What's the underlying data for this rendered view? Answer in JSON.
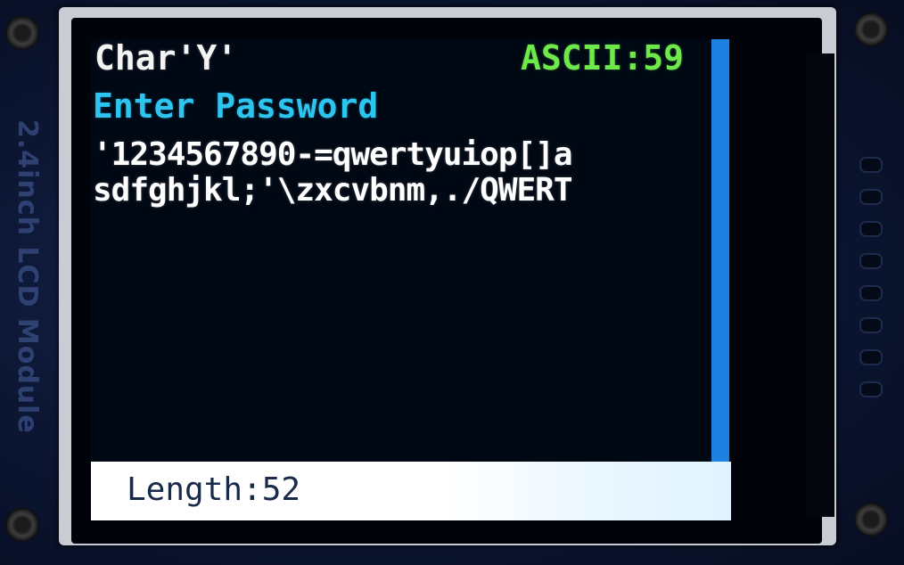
{
  "module": {
    "side_label": "2.4inch LCD Module"
  },
  "display": {
    "char_label": "Char'Y'",
    "ascii_label": "ASCII:59",
    "prompt": "Enter Password",
    "password_lines": [
      "'1234567890-=qwertyuiop[]a",
      "sdfghjkl;'\\zxcvbnm,./QWERT"
    ],
    "length_label": "Length:52"
  },
  "colors": {
    "char_text": "#f4f4f4",
    "ascii_text": "#6ee84a",
    "prompt_text": "#2ec4f0",
    "password_text": "#ffffff",
    "scrollbar": "#1e80e0",
    "status_bar_bg": "#ffffff",
    "status_text": "#1a2a4a"
  }
}
